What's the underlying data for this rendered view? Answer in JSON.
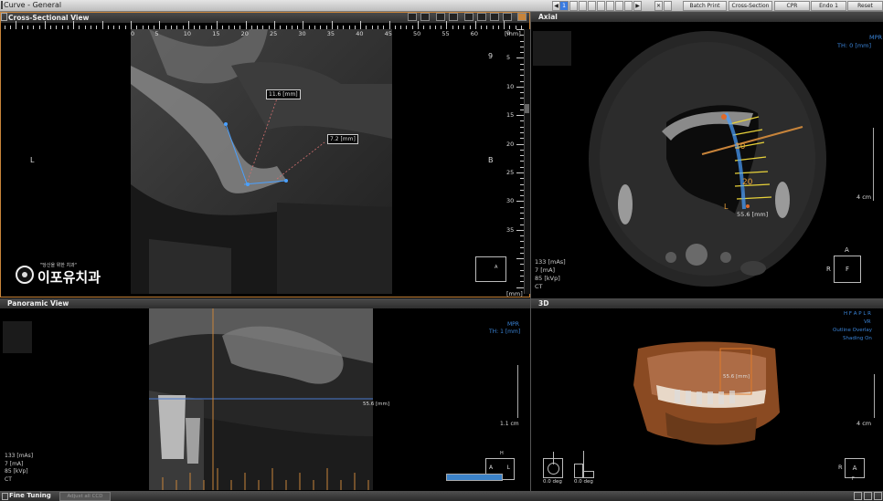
{
  "window": {
    "title": "Curve - General"
  },
  "toolbar": {
    "page": "1",
    "buttons": [
      "Batch Print",
      "Cross-Section",
      "CPR",
      "Endo 1",
      "Reset"
    ]
  },
  "cross_section": {
    "title": "Cross-Sectional View",
    "ruler_h": [
      "0",
      "5",
      "10",
      "15",
      "20",
      "25",
      "30",
      "35",
      "40",
      "45",
      "50",
      "55",
      "60"
    ],
    "ruler_h_unit": "[mm]",
    "ruler_v": [
      "0",
      "5",
      "10",
      "15",
      "20",
      "25",
      "30",
      "35"
    ],
    "ruler_v_unit": "[mm]",
    "slice_number": "9",
    "left_label": "L",
    "right_label": "B",
    "measure1": "11.6 [mm]",
    "measure2": "7.2 [mm]",
    "logo_caption": "\"당신을 위한 치과\"",
    "logo_text": "이포유치과",
    "small_label": "A"
  },
  "axial": {
    "title": "Axial",
    "mode": "MPR",
    "th": "TH: 0 [mm]",
    "info": [
      "133 [mAs]",
      "7 [mA]",
      "85 [kVp]",
      "CT"
    ],
    "scale": "4 cm",
    "curve_marks": [
      "10",
      "20"
    ],
    "curve_length": "55.6 [mm]",
    "curve_L": "L",
    "orient_top": "A",
    "orient_left": "R",
    "orient_box": "F"
  },
  "panoramic": {
    "title": "Panoramic View",
    "mode": "MPR",
    "th": "TH: 1 [mm]",
    "line_label": "55.6 [mm]",
    "scale": "1.1 cm",
    "info": [
      "133 [mAs]",
      "7 [mA]",
      "85 [kVp]",
      "CT"
    ],
    "orient_top": "H",
    "orient_left": "A",
    "orient_right": "L"
  },
  "three_d": {
    "title": "3D",
    "orient_labels": "H F A P L R",
    "vr": "VR",
    "outline": "Outline Overlay",
    "shading": "Shading On",
    "scale": "4 cm",
    "angle1": "0.0 deg",
    "angle2": "0.0 deg",
    "orient_left": "R",
    "orient_box": "A",
    "orient_bottom": "F",
    "measure": "55.6 [mm]"
  },
  "footer": {
    "title": "Fine Tuning",
    "button": "Adjust all CCD"
  }
}
